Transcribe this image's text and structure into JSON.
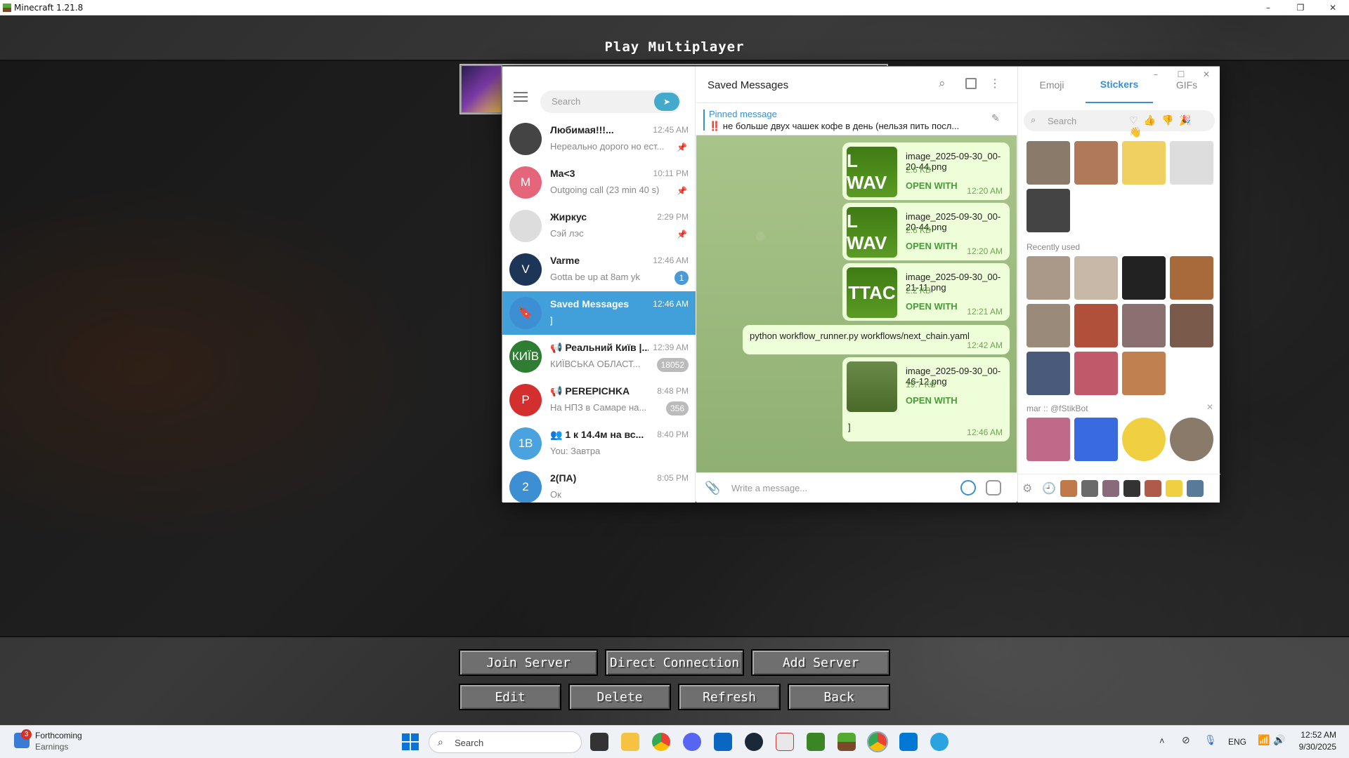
{
  "minecraft": {
    "window_title": "Minecraft 1.21.8",
    "win_controls": [
      "–",
      "❐",
      "✕"
    ],
    "header": "Play Multiplayer",
    "buttons_row1": [
      "Join Server",
      "Direct Connection",
      "Add Server"
    ],
    "buttons_row2": [
      "Edit",
      "Delete",
      "Refresh",
      "Back"
    ]
  },
  "telegram": {
    "win_controls": [
      "–",
      "☐",
      "✕"
    ],
    "search_placeholder": "Search",
    "chats": [
      {
        "name": "Любимая!!!...",
        "time": "12:45 AM",
        "preview": "Нереально дорого но ест...",
        "initials": "",
        "color": "#444",
        "pinned": true
      },
      {
        "name": "Ma<3",
        "time": "10:11 PM",
        "preview": "Outgoing call (23 min 40 s)",
        "initials": "M",
        "color": "#e5657b",
        "pinned": true
      },
      {
        "name": "Жиркус",
        "time": "2:29 PM",
        "preview": "Сэй лэс",
        "initials": "",
        "color": "#ddd",
        "pinned": true
      },
      {
        "name": "Varme",
        "time": "12:46 AM",
        "preview": "Gotta be up at 8am yk",
        "initials": "V",
        "color": "#1d3557",
        "badge": "1"
      },
      {
        "name": "Saved Messages",
        "time": "12:46 AM",
        "preview": "]",
        "initials": "🔖",
        "color": "#3d8fd4",
        "active": true
      },
      {
        "name": "📢 Реальний Київ |...",
        "time": "12:39 AM",
        "preview": "КИЇВСЬКА ОБЛАСТ...",
        "initials": "КИЇВ",
        "color": "#2e7d32",
        "badge": "18052",
        "badge_gray": true
      },
      {
        "name": "📢 PEREPICHKA",
        "time": "8:48 PM",
        "preview": "На НПЗ в Самаре на...",
        "initials": "P",
        "color": "#d32f2f",
        "badge": "356",
        "badge_gray": true
      },
      {
        "name": "👥 1 к 14.4м на вс...",
        "time": "8:40 PM",
        "preview": "You: Завтра",
        "initials": "1B",
        "color": "#4aa3df"
      },
      {
        "name": "2(ПА)",
        "time": "8:05 PM",
        "preview": "Ок",
        "initials": "2",
        "color": "#3d8fd4"
      }
    ],
    "chat_title": "Saved Messages",
    "pinned_label": "Pinned message",
    "pinned_text": "‼️ не больше двух чашек кофе в день (нельзя пить посл...",
    "messages": [
      {
        "thumb": "L WAV",
        "filename": "image_2025-09-30_00-20-44.png",
        "size": "2.6 KB",
        "action": "OPEN WITH",
        "time": "12:20 AM"
      },
      {
        "thumb": "L WAV",
        "filename": "image_2025-09-30_00-20-44.png",
        "size": "2.6 KB",
        "action": "OPEN WITH",
        "time": "12:20 AM"
      },
      {
        "thumb": "TTAC",
        "filename": "image_2025-09-30_00-21-11.png",
        "size": "2.2 KB",
        "action": "OPEN WITH",
        "time": "12:21 AM"
      },
      {
        "text": "python workflow_runner.py workflows/next_chain.yaml",
        "time": "12:42 AM"
      },
      {
        "thumb": "",
        "filename": "image_2025-09-30_00-46-12.png",
        "size": "19.7 KB",
        "action": "OPEN WITH",
        "caption": "]",
        "time": "12:46 AM"
      }
    ],
    "input_placeholder": "Write a message...",
    "tabs": [
      "Emoji",
      "Stickers",
      "GIFs"
    ],
    "sticker_search": "Search",
    "recently_used": "Recently used",
    "pack_title": "mar :: @fStikBot"
  },
  "taskbar": {
    "weather_title": "Forthcoming",
    "weather_sub": "Earnings",
    "weather_badge": "3",
    "search": "Search",
    "lang": "ENG",
    "time": "12:52 AM",
    "date": "9/30/2025"
  }
}
